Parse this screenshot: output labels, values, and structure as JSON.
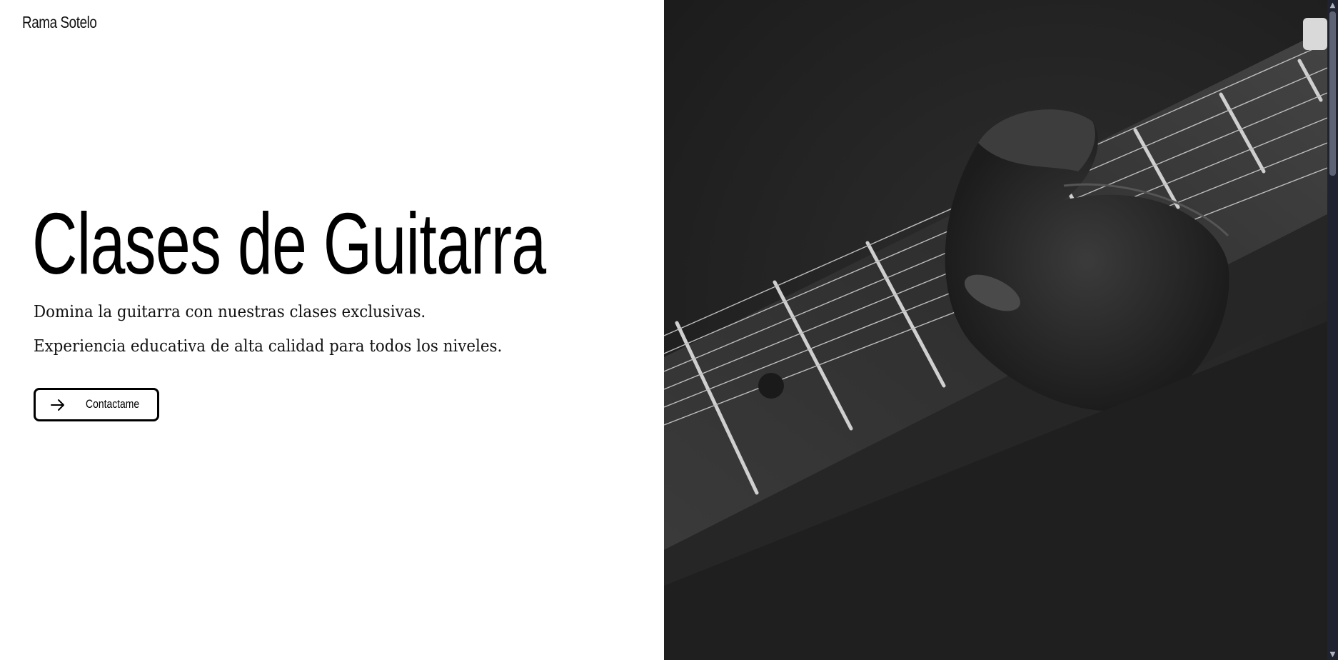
{
  "header": {
    "brand": "Rama Sotelo"
  },
  "hero": {
    "title": "Clases de Guitarra",
    "line1": "Domina la guitarra con nuestras clases exclusivas.",
    "line2": "Experiencia educativa de alta calidad para todos los niveles.",
    "cta_label": "Contactame",
    "cta_icon": "arrow-right-icon"
  },
  "image": {
    "subject": "guitar-fretboard-photo",
    "tone": "black-and-white"
  },
  "colors": {
    "background": "#ffffff",
    "text": "#000000",
    "photo_dark": "#232323",
    "scrollbar": "#1f2330"
  }
}
